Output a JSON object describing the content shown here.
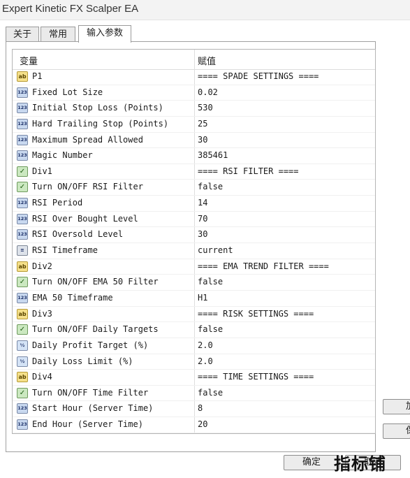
{
  "window": {
    "title": "Expert Kinetic FX Scalper EA"
  },
  "tabs": [
    {
      "label": "关于"
    },
    {
      "label": "常用"
    },
    {
      "label": "输入参数"
    }
  ],
  "table": {
    "headers": {
      "variable": "变量",
      "value": "赋值"
    },
    "rows": [
      {
        "icon": "string-icon",
        "badge": "ab",
        "name": "P1",
        "value": "==== SPADE SETTINGS ===="
      },
      {
        "icon": "number-icon",
        "badge": "123",
        "name": "Fixed Lot Size",
        "value": "0.02"
      },
      {
        "icon": "number-icon",
        "badge": "123",
        "name": "Initial Stop Loss (Points)",
        "value": "530"
      },
      {
        "icon": "number-icon",
        "badge": "123",
        "name": "Hard Trailing Stop (Points)",
        "value": "25"
      },
      {
        "icon": "number-icon",
        "badge": "123",
        "name": "Maximum Spread Allowed",
        "value": "30"
      },
      {
        "icon": "number-icon",
        "badge": "123",
        "name": "Magic Number",
        "value": "385461"
      },
      {
        "icon": "bool-icon",
        "badge": "✓",
        "name": "Div1",
        "value": "==== RSI FILTER ===="
      },
      {
        "icon": "bool-icon",
        "badge": "✓",
        "name": "Turn ON/OFF RSI Filter",
        "value": "false"
      },
      {
        "icon": "number-icon",
        "badge": "123",
        "name": "RSI Period",
        "value": "14"
      },
      {
        "icon": "number-icon",
        "badge": "123",
        "name": "RSI Over Bought Level",
        "value": "70"
      },
      {
        "icon": "number-icon",
        "badge": "123",
        "name": "RSI Oversold Level",
        "value": "30"
      },
      {
        "icon": "enum-icon",
        "badge": "≡",
        "name": "RSI Timeframe",
        "value": "current"
      },
      {
        "icon": "string-icon",
        "badge": "ab",
        "name": "Div2",
        "value": "==== EMA TREND FILTER ===="
      },
      {
        "icon": "bool-icon",
        "badge": "✓",
        "name": "Turn ON/OFF EMA 50 Filter",
        "value": "false"
      },
      {
        "icon": "number-icon",
        "badge": "123",
        "name": "EMA 50 Timeframe",
        "value": "H1"
      },
      {
        "icon": "string-icon",
        "badge": "ab",
        "name": "Div3",
        "value": "==== RISK SETTINGS ===="
      },
      {
        "icon": "bool-icon",
        "badge": "✓",
        "name": "Turn ON/OFF Daily Targets",
        "value": "false"
      },
      {
        "icon": "double-icon",
        "badge": "½",
        "name": "Daily Profit Target (%)",
        "value": "2.0"
      },
      {
        "icon": "double-icon",
        "badge": "½",
        "name": "Daily Loss Limit (%)",
        "value": "2.0"
      },
      {
        "icon": "string-icon",
        "badge": "ab",
        "name": "Div4",
        "value": "==== TIME SETTINGS ===="
      },
      {
        "icon": "bool-icon",
        "badge": "✓",
        "name": "Turn ON/OFF Time Filter",
        "value": "false"
      },
      {
        "icon": "number-icon",
        "badge": "123",
        "name": "Start Hour (Server Time)",
        "value": "8"
      },
      {
        "icon": "number-icon",
        "badge": "123",
        "name": "End Hour (Server Time)",
        "value": "20"
      }
    ]
  },
  "buttons": {
    "side_top": "加",
    "side_bottom": "保",
    "ok": "确定",
    "cancel": "取消"
  },
  "watermark": "指标铺"
}
